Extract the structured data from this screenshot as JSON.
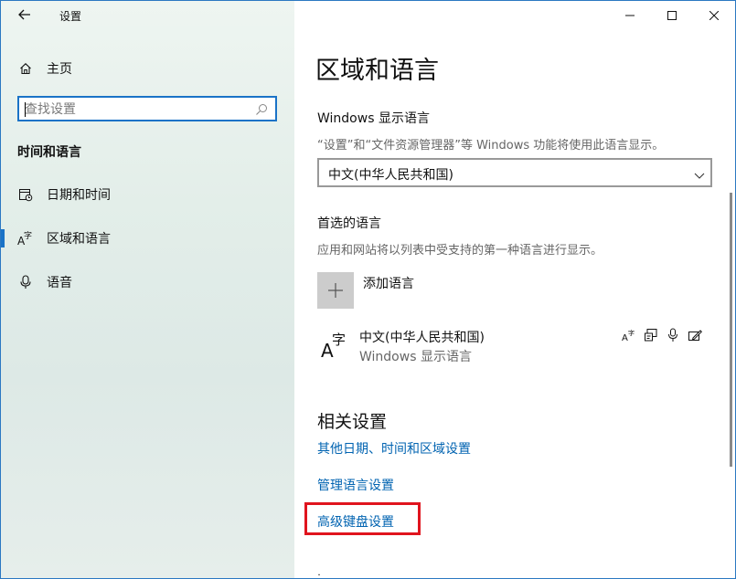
{
  "window": {
    "title": "设置"
  },
  "sidebar": {
    "home_label": "主页",
    "search_placeholder": "查找设置",
    "section_title": "时间和语言",
    "items": [
      {
        "label": "日期和时间",
        "icon": "calendar-clock-icon",
        "active": false
      },
      {
        "label": "区域和语言",
        "icon": "language-icon",
        "active": true
      },
      {
        "label": "语音",
        "icon": "microphone-icon",
        "active": false
      }
    ]
  },
  "content": {
    "page_title": "区域和语言",
    "display_language": {
      "label": "Windows 显示语言",
      "description": "“设置”和“文件资源管理器”等 Windows 功能将使用此语言显示。",
      "selected": "中文(中华人民共和国)"
    },
    "preferred": {
      "label": "首选的语言",
      "description": "应用和网站将以列表中受支持的第一种语言进行显示。",
      "add_label": "添加语言",
      "languages": [
        {
          "name": "中文(中华人民共和国)",
          "sub": "Windows 显示语言"
        }
      ]
    },
    "related": {
      "title": "相关设置",
      "links": [
        "其他日期、时间和区域设置",
        "管理语言设置",
        "高级键盘设置"
      ]
    }
  },
  "colors": {
    "accent": "#0063b1",
    "highlight": "#e0141e",
    "sidebar_bg": "#e3eee9"
  }
}
